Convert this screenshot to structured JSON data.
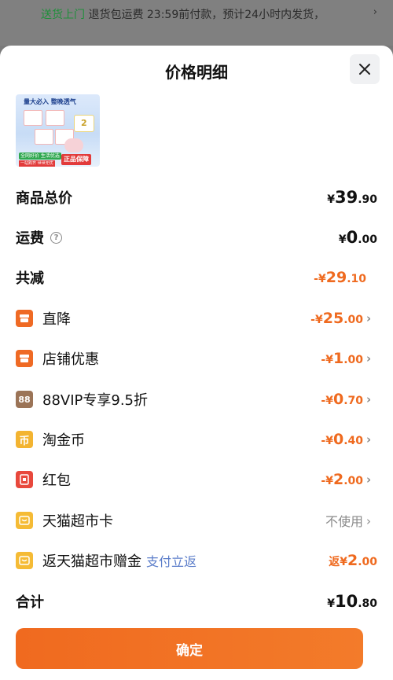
{
  "topbar": {
    "green_text": "送货上门",
    "text": "退货包运费 23:59前付款，预计24小时内发货，",
    "chevron": "›"
  },
  "title": "价格明细",
  "product_image": {
    "headline": "量大必入 整晚透气",
    "cup_number": "2",
    "badge_green": "全网好价 生活优选",
    "badge_red_small": "一站购齐 世世无忧",
    "badge_guarantee": "正品保障"
  },
  "rows": {
    "total": {
      "label": "商品总价",
      "cur": "¥",
      "int": "39",
      "dec": ".90"
    },
    "shipping": {
      "label": "运费",
      "help": "?",
      "cur": "¥",
      "int": "0",
      "dec": ".00"
    },
    "discount_total": {
      "label": "共减",
      "cur": "-¥",
      "int": "29",
      "dec": ".10"
    },
    "direct": {
      "label": "直降",
      "cur": "-¥",
      "int": "25",
      "dec": ".00"
    },
    "store": {
      "label": "店铺优惠",
      "cur": "-¥",
      "int": "1",
      "dec": ".00"
    },
    "vip": {
      "icon_text": "88",
      "label": "88VIP专享9.5折",
      "cur": "-¥",
      "int": "0",
      "dec": ".70"
    },
    "coin": {
      "icon_text": "币",
      "label": "淘金币",
      "cur": "-¥",
      "int": "0",
      "dec": ".40"
    },
    "redpacket": {
      "label": "红包",
      "cur": "-¥",
      "int": "2",
      "dec": ".00"
    },
    "tmall_card": {
      "label": "天猫超市卡",
      "value": "不使用"
    },
    "cashback": {
      "label": "返天猫超市赠金",
      "sublabel": "支付立返",
      "cur": "返¥",
      "int": "2",
      "dec": ".00"
    },
    "sum": {
      "label": "合计",
      "cur": "¥",
      "int": "10",
      "dec": ".80"
    }
  },
  "confirm_label": "确定",
  "colors": {
    "accent": "#ef6a1f",
    "sublabel": "#5a7cc9"
  },
  "icons": [
    "close-icon",
    "help-icon",
    "shop-icon",
    "store-icon",
    "vip88-icon",
    "coin-icon",
    "red-packet-icon",
    "card-icon",
    "gift-icon",
    "chevron-right-icon"
  ]
}
